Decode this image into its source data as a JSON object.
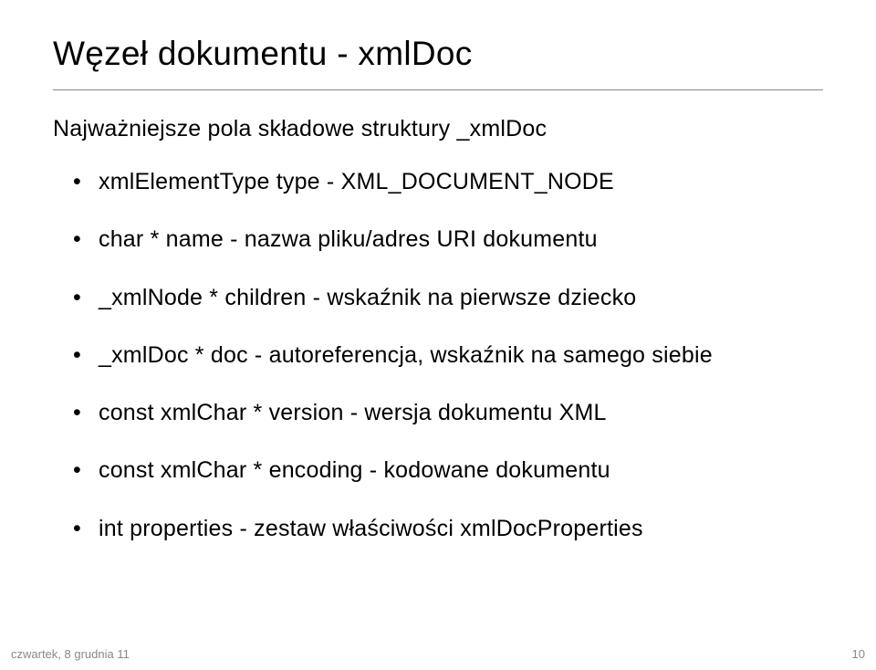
{
  "title": "Węzeł dokumentu - xmlDoc",
  "subtitle": "Najważniejsze pola składowe struktury _xmlDoc",
  "bullets": [
    "xmlElementType type - XML_DOCUMENT_NODE",
    "char * name - nazwa pliku/adres URI dokumentu",
    "_xmlNode * children - wskaźnik na pierwsze dziecko",
    "_xmlDoc * doc - autoreferencja, wskaźnik na samego siebie",
    "const xmlChar *   version - wersja dokumentu XML",
    "const xmlChar * encoding - kodowane dokumentu",
    "int properties - zestaw właściwości xmlDocProperties"
  ],
  "footer": {
    "date": "czwartek, 8 grudnia 11",
    "page": "10"
  }
}
